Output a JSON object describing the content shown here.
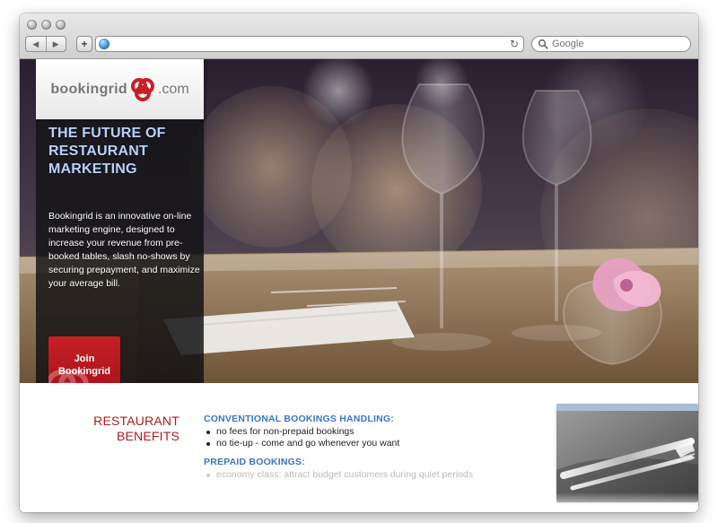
{
  "browser": {
    "address_value": "",
    "search_placeholder": "Google",
    "colors": {
      "chrome_top": "#e9e9e9",
      "chrome_bottom": "#cfcfcf"
    },
    "icons": {
      "back": "chevron-left-icon",
      "forward": "chevron-right-icon",
      "add_tab": "plus-icon",
      "site": "globe-icon",
      "reload": "reload-icon",
      "search": "search-icon"
    }
  },
  "site": {
    "brand": {
      "name": "bookingrid",
      "tld": ".com",
      "accent": "#c62027"
    },
    "hero": {
      "title_line1": "THE FUTURE OF",
      "title_line2": "RESTAURANT",
      "title_line3": "MARKETING",
      "description": "Bookingrid is an innovative on-line marketing engine, designed to increase your revenue from pre-booked tables, slash no-shows by securing prepayment, and maximize your average bill.",
      "cta_label": "Join\nBookingrid"
    },
    "benefits": {
      "title": "RESTAURANT\nBENEFITS",
      "sections": [
        {
          "heading": "CONVENTIONAL BOOKINGS HANDLING:",
          "items": [
            "no fees for non-prepaid bookings",
            "no tie-up - come and go whenever you want"
          ]
        },
        {
          "heading": "PREPAID BOOKINGS:",
          "items": [
            "economy class: attract budget customers during quiet periods"
          ]
        }
      ]
    }
  }
}
